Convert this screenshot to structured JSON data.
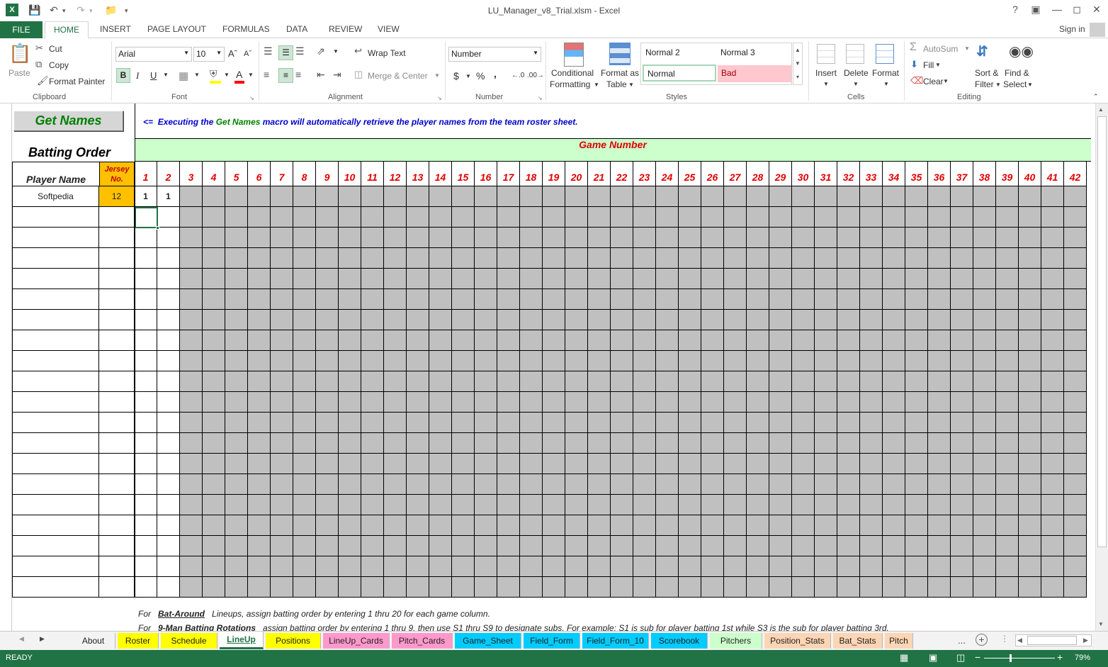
{
  "window": {
    "title": "LU_Manager_v8_Trial.xlsm - Excel",
    "help": "?",
    "sign_in": "Sign in"
  },
  "menu": {
    "file": "FILE",
    "tabs": [
      "HOME",
      "INSERT",
      "PAGE LAYOUT",
      "FORMULAS",
      "DATA",
      "REVIEW",
      "VIEW"
    ]
  },
  "ribbon": {
    "clipboard": {
      "label": "Clipboard",
      "paste": "Paste",
      "cut": "Cut",
      "copy": "Copy",
      "format_painter": "Format Painter"
    },
    "font": {
      "label": "Font",
      "name": "Arial",
      "size": "10",
      "bold": "B",
      "italic": "I",
      "underline": "U"
    },
    "alignment": {
      "label": "Alignment",
      "wrap_text": "Wrap Text",
      "merge_center": "Merge & Center"
    },
    "number": {
      "label": "Number",
      "format": "Number",
      "currency": "$",
      "percent": "%",
      "comma": ","
    },
    "styles": {
      "label": "Styles",
      "conditional": [
        "Conditional",
        "Formatting"
      ],
      "format_table": [
        "Format as",
        "Table"
      ],
      "normal2": "Normal 2",
      "normal3": "Normal 3",
      "normal": "Normal",
      "bad": "Bad"
    },
    "cells": {
      "label": "Cells",
      "insert": "Insert",
      "delete": "Delete",
      "format": "Format"
    },
    "editing": {
      "label": "Editing",
      "autosum": "AutoSum",
      "fill": "Fill",
      "clear": "Clear",
      "sort": [
        "Sort &",
        "Filter"
      ],
      "find": [
        "Find &",
        "Select"
      ]
    }
  },
  "sheet": {
    "get_names_button": "Get Names",
    "note_arrow": "<=",
    "note_pre": "Executing the",
    "note_macro": "Get Names",
    "note_post": "macro will automatically retrieve the player names from the team roster sheet.",
    "game_number": "Game Number",
    "batting_order": "Batting Order",
    "player_name_header": "Player Name",
    "jersey_header": [
      "Jersey",
      "No."
    ],
    "game_numbers": [
      "1",
      "2",
      "3",
      "4",
      "5",
      "6",
      "7",
      "8",
      "9",
      "10",
      "11",
      "12",
      "13",
      "14",
      "15",
      "16",
      "17",
      "18",
      "19",
      "20",
      "21",
      "22",
      "23",
      "24",
      "25",
      "26",
      "27",
      "28",
      "29",
      "30",
      "31",
      "32",
      "33",
      "34",
      "35",
      "36",
      "37",
      "38",
      "39",
      "40",
      "41",
      "42"
    ],
    "rows": [
      {
        "player": "Softpedia",
        "jersey": "12",
        "games": [
          "1",
          "1"
        ]
      }
    ],
    "footnote1_pre": "For",
    "footnote1_bold": "Bat-Around",
    "footnote1_post": "Lineups, assign batting order by entering 1 thru 20 for each game column.",
    "footnote2_pre": "For",
    "footnote2_bold": "9-Man Batting Rotations",
    "footnote2_post": "assign batting order by entering 1 thru 9, then use S1 thru S9 to designate subs. For example: S1 is sub for player batting 1st while S3 is the sub for player batting 3rd."
  },
  "sheet_tabs": [
    {
      "name": "About",
      "color": "#f3f3f3"
    },
    {
      "name": "Roster",
      "color": "#ffff00"
    },
    {
      "name": "Schedule",
      "color": "#ffff00"
    },
    {
      "name": "LineUp",
      "color": "#ffffff"
    },
    {
      "name": "Positions",
      "color": "#ffff00"
    },
    {
      "name": "LineUp_Cards",
      "color": "#ff99cc"
    },
    {
      "name": "Pitch_Cards",
      "color": "#ff99cc"
    },
    {
      "name": "Game_Sheet",
      "color": "#00ccff"
    },
    {
      "name": "Field_Form",
      "color": "#00ccff"
    },
    {
      "name": "Field_Form_10",
      "color": "#00ccff"
    },
    {
      "name": "Scorebook",
      "color": "#00ccff"
    },
    {
      "name": "Pitchers",
      "color": "#ccffcc"
    },
    {
      "name": "Position_Stats",
      "color": "#fcd5b4"
    },
    {
      "name": "Bat_Stats",
      "color": "#fcd5b4"
    },
    {
      "name": "Pitch",
      "color": "#fcd5b4"
    }
  ],
  "tabbar": {
    "more": "...",
    "add": "+"
  },
  "status": {
    "ready": "READY",
    "zoom": "79%",
    "zoom_minus": "−",
    "zoom_plus": "+"
  }
}
